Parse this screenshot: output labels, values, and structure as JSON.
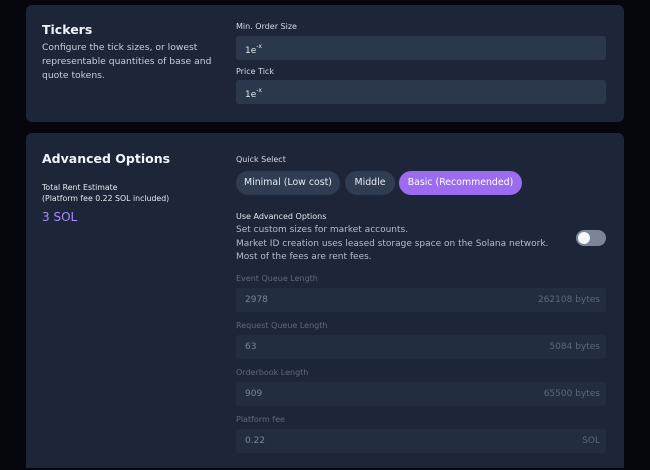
{
  "tickers": {
    "title": "Tickers",
    "description": "Configure the tick sizes, or lowest representable quantities of base and quote tokens.",
    "min_order_size": {
      "label": "Min. Order Size",
      "value_base": "1e",
      "value_exp": "-x"
    },
    "price_tick": {
      "label": "Price Tick",
      "value_base": "1e",
      "value_exp": "-x"
    }
  },
  "advanced": {
    "title": "Advanced Options",
    "rent_label": "Total Rent Estimate",
    "rent_note": "(Platform fee 0.22 SOL included)",
    "rent_value": "3 SOL",
    "quick_select": {
      "label": "Quick Select",
      "options": [
        "Minimal (Low cost)",
        "Middle",
        "Basic (Recommended)"
      ],
      "selected": "Basic (Recommended)"
    },
    "use_advanced": {
      "label": "Use Advanced Options",
      "lines": [
        "Set custom sizes for market accounts.",
        "Market ID creation uses leased storage space on the Solana network.",
        "Most of the fees are rent fees."
      ],
      "enabled": false
    },
    "fields": [
      {
        "label": "Event Queue Length",
        "value": "2978",
        "suffix": "262108 bytes"
      },
      {
        "label": "Request Queue Length",
        "value": "63",
        "suffix": "5084 bytes"
      },
      {
        "label": "Orderbook Length",
        "value": "909",
        "suffix": "65500 bytes"
      },
      {
        "label": "Platform fee",
        "value": "0.22",
        "suffix": "SOL"
      }
    ]
  },
  "colors": {
    "accent": "#9c6bf0",
    "rent_value": "#a98aff",
    "card_bg": "#1c2638",
    "input_bg": "#2b384c"
  }
}
